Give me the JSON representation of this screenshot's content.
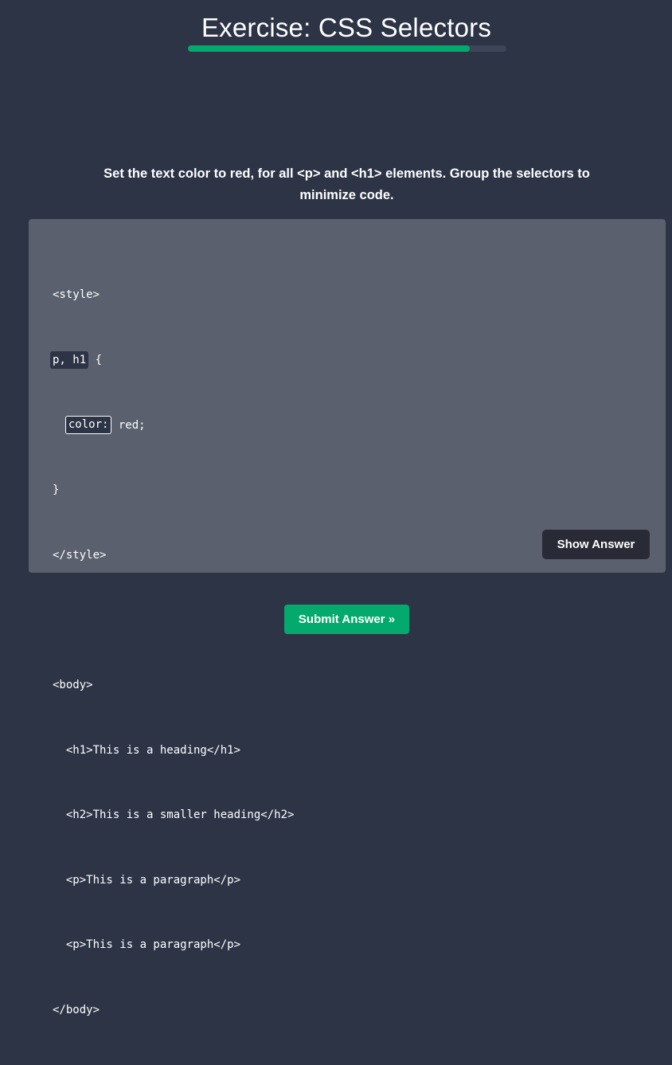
{
  "header": {
    "title": "Exercise: CSS Selectors",
    "progress_fraction": 0.885
  },
  "instruction": "Set the text color to red, for all <p> and <h1> elements. Group the selectors to minimize code.",
  "code": {
    "line_style_open": "<style>",
    "blank_selectors": "p, h1",
    "line_brace_open": " {",
    "line_indent": "  ",
    "blank_property": "color:",
    "line_value": " red;",
    "line_brace_close": "}",
    "line_style_close": "</style>",
    "line_body_open": "<body>",
    "line_h1": "  <h1>This is a heading</h1>",
    "line_h2": "  <h2>This is a smaller heading</h2>",
    "line_p1": "  <p>This is a paragraph</p>",
    "line_p2": "  <p>This is a paragraph</p>",
    "line_body_close": "</body>"
  },
  "buttons": {
    "show_answer": "Show Answer",
    "submit": "Submit Answer »"
  },
  "colors": {
    "page_background": "#2d3446",
    "panel_background": "#5a606d",
    "accent_green": "#04aa6d",
    "progress_track": "#3e4558",
    "dark_button": "#282a35"
  }
}
